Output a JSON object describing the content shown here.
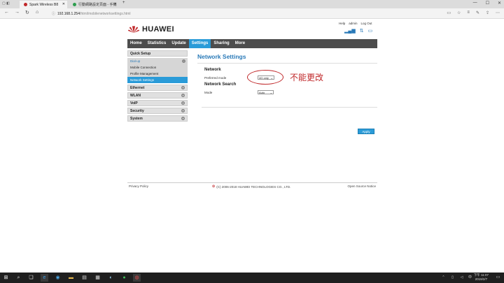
{
  "browser": {
    "tabs": [
      {
        "label": "Spark Wireless B8",
        "color": "#c0282a"
      },
      {
        "label": "行動網路設定頁面 - 手機",
        "color": "#2e9e4f"
      }
    ],
    "new_tab": "+",
    "address": {
      "host": "192.168.1.254",
      "path": "/html/mobilenetworksettings.html"
    }
  },
  "router": {
    "brand": "HUAWEI",
    "top_links": [
      "Help",
      "admin",
      "Log Out"
    ],
    "menu": [
      "Home",
      "Statistics",
      "Update",
      "Settings",
      "Sharing",
      "More"
    ],
    "sidebar": {
      "quick_setup": "Quick Setup",
      "dialup": "Dial-up",
      "dialup_items": [
        "Mobile Connection",
        "Profile Management",
        "Network Settings"
      ],
      "groups": [
        "Ethernet",
        "WLAN",
        "VoIP",
        "Security",
        "System"
      ]
    },
    "content": {
      "title": "Network Settings",
      "network_section": "Network",
      "preferred_mode_label": "Preferred mode",
      "preferred_mode_value": "4G only",
      "network_search_section": "Network Search",
      "mode_label": "Mode",
      "mode_value": "Auto",
      "apply": "Apply",
      "annotation": "不能更改"
    },
    "footer": {
      "privacy": "Privacy Policy",
      "copyright": "(C) 2006-2018 HUAWEI TECHNOLOGIES CO., LTD.",
      "notice": "Open Source Notice"
    }
  },
  "taskbar": {
    "time": "下午 11:07",
    "date": "2019/2/7"
  },
  "colors": {
    "accent": "#2a9bd8",
    "menubar": "#4d4d4d",
    "annotation": "#c0282a",
    "brand": "#c0282a"
  }
}
